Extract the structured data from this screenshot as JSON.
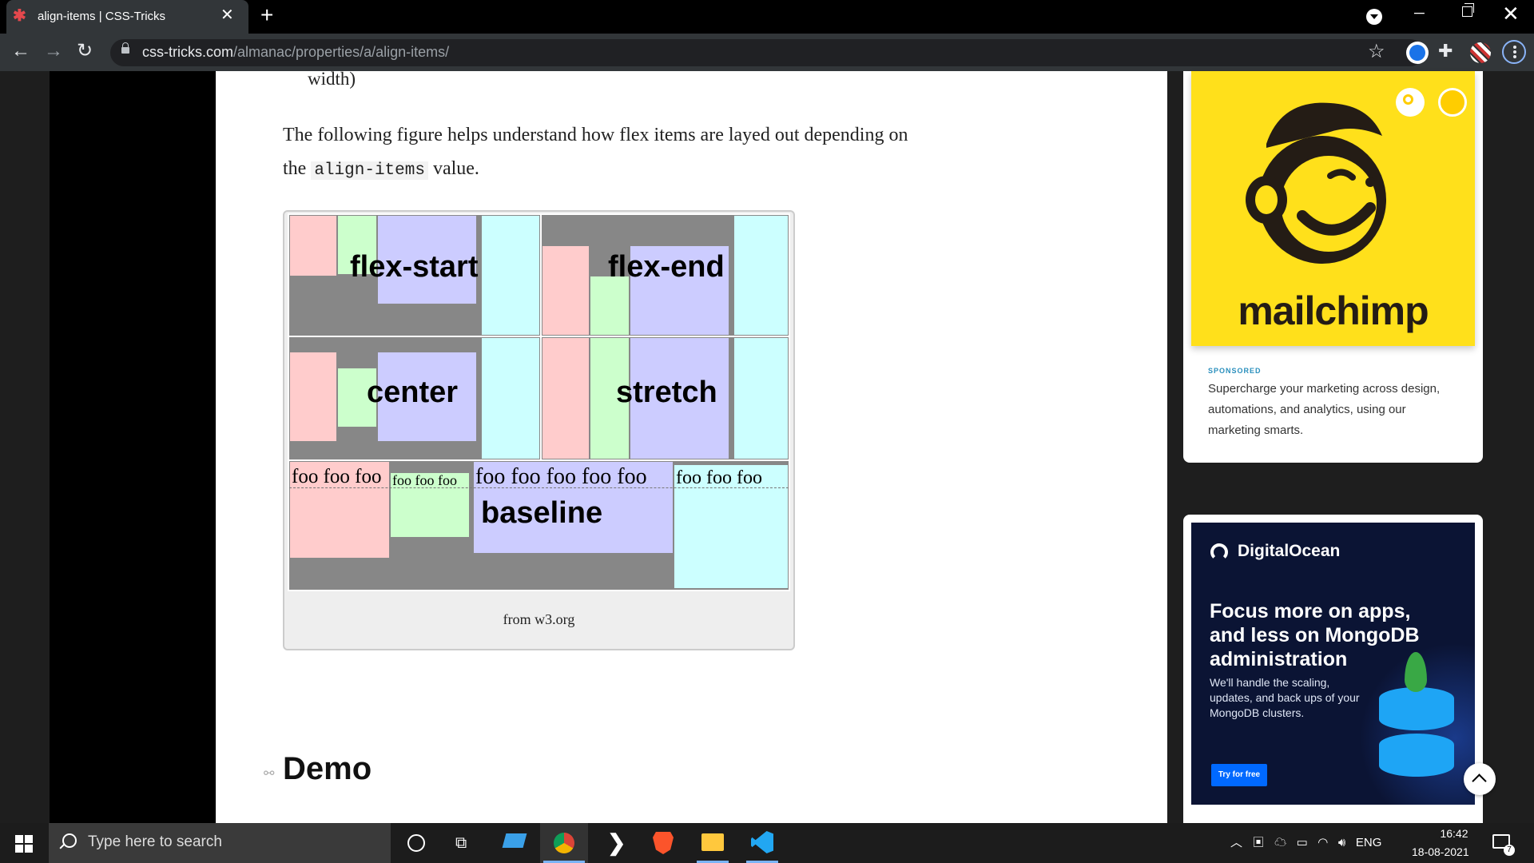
{
  "browser": {
    "tab_title": "align-items | CSS-Tricks",
    "url_host": "css-tricks.com",
    "url_path": "/almanac/properties/a/align-items/"
  },
  "article": {
    "continued_line": "width)",
    "para_line1": "The following figure helps understand how flex items are layed out depending on",
    "para_the": "the",
    "para_code": "align-items",
    "para_value": "value.",
    "figure": {
      "labels": {
        "flex_start": "flex-start",
        "flex_end": "flex-end",
        "center": "center",
        "stretch": "stretch",
        "baseline": "baseline"
      },
      "foo_texts": {
        "a": "foo foo foo",
        "b": "foo foo foo",
        "c": "foo foo foo foo foo",
        "d": "foo foo foo"
      },
      "caption": "from w3.org"
    },
    "demo_heading": "Demo"
  },
  "sidebar": {
    "ad1": {
      "brand": "mailchimp",
      "sponsored": "SPONSORED",
      "text": "Supercharge your marketing across design, automations, and analytics, using our marketing smarts."
    },
    "ad2": {
      "brand": "DigitalOcean",
      "headline": "Focus more on apps, and less on MongoDB administration",
      "subtext": "We'll handle the scaling, updates, and back ups of your MongoDB clusters.",
      "cta": "Try for free"
    }
  },
  "taskbar": {
    "search_placeholder": "Type here to search",
    "lang": "ENG",
    "time": "16:42",
    "date": "18-08-2021",
    "notification_count": "7"
  }
}
